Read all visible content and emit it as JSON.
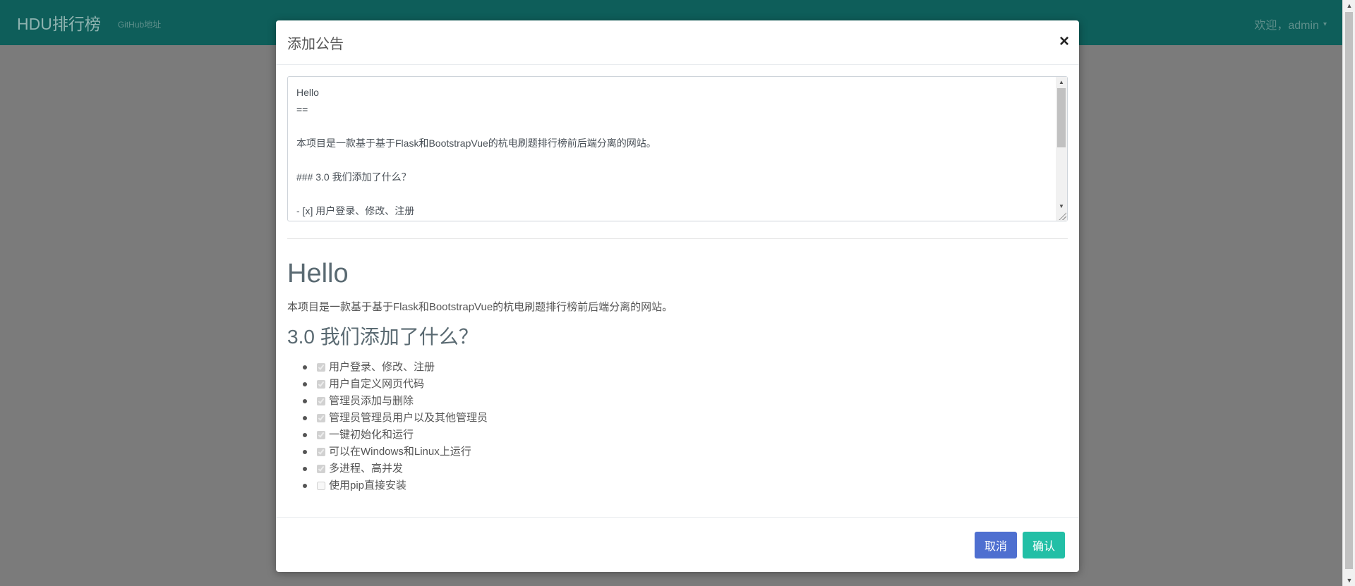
{
  "navbar": {
    "brand": "HDU排行榜",
    "github_link": "GitHub地址",
    "user_greeting": "欢迎，admin",
    "caret_icon": "▾"
  },
  "modal": {
    "title": "添加公告",
    "close_label": "×",
    "editor_text": "Hello\n==\n\n本项目是一款基于基于Flask和BootstrapVue的杭电刷题排行榜前后端分离的网站。\n\n### 3.0 我们添加了什么？\n\n- [x] 用户登录、修改、注册\n- [x] 用户自定义网页代码",
    "preview": {
      "heading": "Hello",
      "paragraph": "本项目是一款基于基于Flask和BootstrapVue的杭电刷题排行榜前后端分离的网站。",
      "subheading": "3.0 我们添加了什么？",
      "tasks": [
        {
          "label": "用户登录、修改、注册",
          "checked": true
        },
        {
          "label": "用户自定义网页代码",
          "checked": true
        },
        {
          "label": "管理员添加与删除",
          "checked": true
        },
        {
          "label": "管理员管理员用户以及其他管理员",
          "checked": true
        },
        {
          "label": "一键初始化和运行",
          "checked": true
        },
        {
          "label": "可以在Windows和Linux上运行",
          "checked": true
        },
        {
          "label": "多进程、高并发",
          "checked": true
        },
        {
          "label": "使用pip直接安装",
          "checked": false
        }
      ]
    },
    "footer": {
      "cancel_label": "取消",
      "confirm_label": "确认"
    }
  },
  "colors": {
    "navbar": "#0e5e5a",
    "cancel_button": "#4e6fd0",
    "confirm_button": "#22bfa6"
  }
}
